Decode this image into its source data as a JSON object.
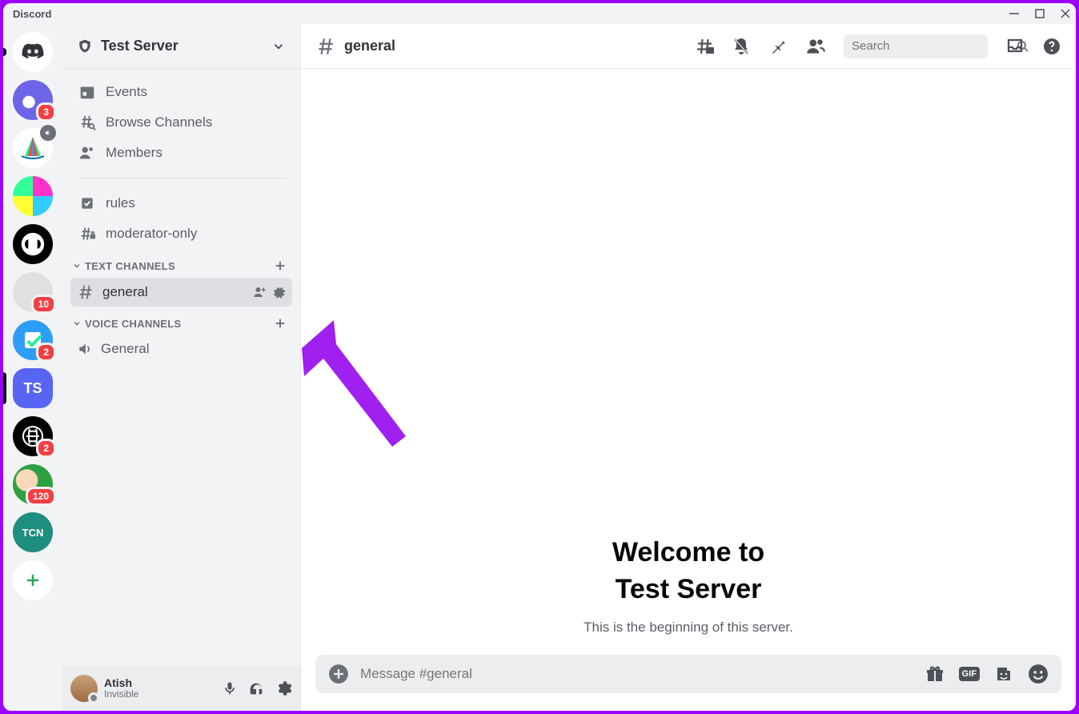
{
  "titlebar": {
    "app_name": "Discord"
  },
  "servers": [
    {
      "id": "home",
      "bg": "#ffffff",
      "icon": "discord"
    },
    {
      "id": "s1",
      "bg": "#6e64e7",
      "badge": "3"
    },
    {
      "id": "s2",
      "bg": "#ffffff",
      "overlay": "speaker"
    },
    {
      "id": "s3",
      "bg": "#ffffff"
    },
    {
      "id": "s4",
      "bg": "#000000",
      "fg": "#fff"
    },
    {
      "id": "s5",
      "bg": "#e0e0e0",
      "badge": "10"
    },
    {
      "id": "s6",
      "bg": "#2e9df7",
      "badge": "2"
    },
    {
      "id": "s7",
      "bg": "#5865f2",
      "label": "TS",
      "fg": "#fff",
      "active": true
    },
    {
      "id": "s8",
      "bg": "#000000",
      "badge": "2",
      "fg": "#fff"
    },
    {
      "id": "s9",
      "bg": "#2ea043",
      "badge": "120"
    },
    {
      "id": "s10",
      "bg": "#1e8e7e",
      "fg": "#fff"
    },
    {
      "id": "add",
      "bg": "#ffffff",
      "icon": "plus",
      "fg": "#23a55a"
    }
  ],
  "sidebar": {
    "server_name": "Test Server",
    "nav": [
      {
        "icon": "calendar",
        "label": "Events"
      },
      {
        "icon": "browse",
        "label": "Browse Channels"
      },
      {
        "icon": "members",
        "label": "Members"
      }
    ],
    "pins": [
      {
        "icon": "rules",
        "label": "rules"
      },
      {
        "icon": "hashlock",
        "label": "moderator-only"
      }
    ],
    "categories": [
      {
        "name": "TEXT CHANNELS",
        "channels": [
          {
            "icon": "hash",
            "label": "general",
            "selected": true,
            "show_actions": true
          }
        ]
      },
      {
        "name": "VOICE CHANNELS",
        "channels": [
          {
            "icon": "speaker",
            "label": "General"
          }
        ]
      }
    ]
  },
  "user_panel": {
    "name": "Atish",
    "status": "Invisible"
  },
  "header": {
    "channel": "general",
    "search_placeholder": "Search"
  },
  "welcome": {
    "line1": "Welcome to",
    "line2": "Test Server",
    "sub": "This is the beginning of this server."
  },
  "composer": {
    "placeholder": "Message #general"
  }
}
